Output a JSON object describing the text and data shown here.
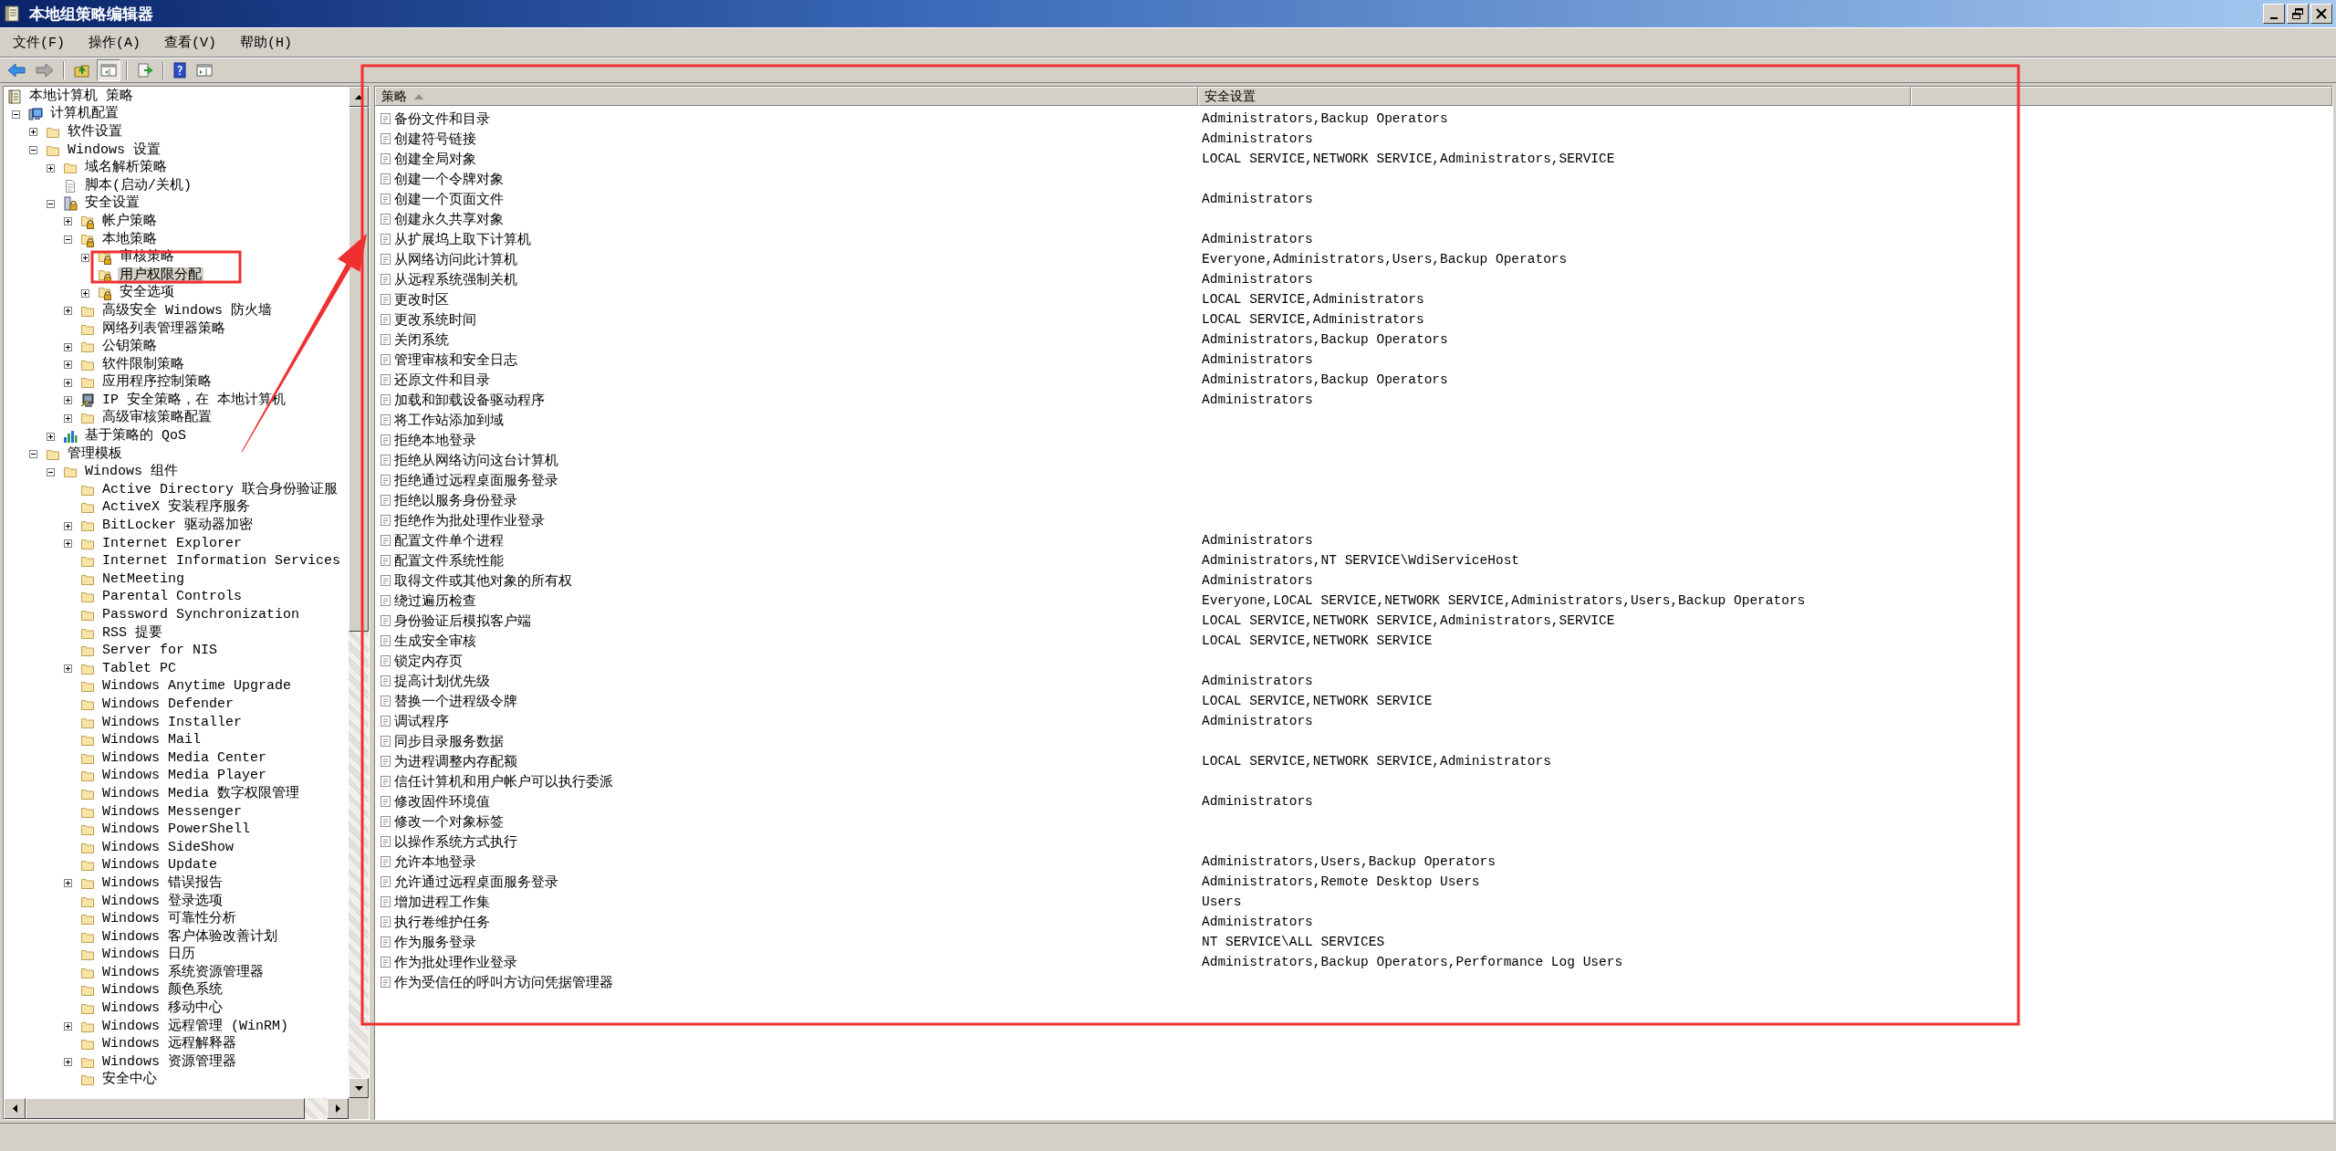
{
  "window": {
    "title": "本地组策略编辑器"
  },
  "menu": [
    "文件(F)",
    "操作(A)",
    "查看(V)",
    "帮助(H)"
  ],
  "tree": [
    {
      "label": "本地计算机 策略",
      "kind": "root",
      "selected": false,
      "children": [
        {
          "label": "计算机配置",
          "kind": "computer",
          "expanded": true,
          "selected": false,
          "children": [
            {
              "label": "软件设置",
              "kind": "folder",
              "expanded": false,
              "selected": false
            },
            {
              "label": "Windows 设置",
              "kind": "folder",
              "expanded": true,
              "selected": false,
              "children": [
                {
                  "label": "域名解析策略",
                  "kind": "folder",
                  "expanded": false,
                  "selected": false
                },
                {
                  "label": "脚本(启动/关机)",
                  "kind": "script",
                  "selected": false
                },
                {
                  "label": "安全设置",
                  "kind": "security",
                  "expanded": true,
                  "selected": false,
                  "children": [
                    {
                      "label": "帐户策略",
                      "kind": "lock-folder",
                      "expanded": false,
                      "selected": false
                    },
                    {
                      "label": "本地策略",
                      "kind": "lock-folder",
                      "expanded": true,
                      "selected": false,
                      "children": [
                        {
                          "label": "审核策略",
                          "kind": "lock-folder",
                          "expanded": false,
                          "selected": false
                        },
                        {
                          "label": "用户权限分配",
                          "kind": "lock-folder",
                          "selected": true
                        },
                        {
                          "label": "安全选项",
                          "kind": "lock-folder",
                          "expanded": false,
                          "selected": false
                        }
                      ]
                    },
                    {
                      "label": "高级安全 Windows 防火墙",
                      "kind": "folder",
                      "expanded": false,
                      "selected": false
                    },
                    {
                      "label": "网络列表管理器策略",
                      "kind": "folder",
                      "selected": false
                    },
                    {
                      "label": "公钥策略",
                      "kind": "folder",
                      "expanded": false,
                      "selected": false
                    },
                    {
                      "label": "软件限制策略",
                      "kind": "folder",
                      "expanded": false,
                      "selected": false
                    },
                    {
                      "label": "应用程序控制策略",
                      "kind": "folder",
                      "expanded": false,
                      "selected": false
                    },
                    {
                      "label": "IP 安全策略，在 本地计算机",
                      "kind": "ip",
                      "expanded": false,
                      "selected": false
                    },
                    {
                      "label": "高级审核策略配置",
                      "kind": "folder",
                      "expanded": false,
                      "selected": false
                    }
                  ]
                },
                {
                  "label": "基于策略的 QoS",
                  "kind": "chart",
                  "expanded": false,
                  "selected": false
                }
              ]
            },
            {
              "label": "管理模板",
              "kind": "folder",
              "expanded": true,
              "selected": false,
              "children": [
                {
                  "label": "Windows 组件",
                  "kind": "folder",
                  "expanded": true,
                  "selected": false,
                  "children": [
                    {
                      "label": "Active Directory 联合身份验证服",
                      "kind": "folder",
                      "selected": false
                    },
                    {
                      "label": "ActiveX 安装程序服务",
                      "kind": "folder",
                      "selected": false
                    },
                    {
                      "label": "BitLocker 驱动器加密",
                      "kind": "folder",
                      "expanded": false,
                      "selected": false
                    },
                    {
                      "label": "Internet Explorer",
                      "kind": "folder",
                      "expanded": false,
                      "selected": false
                    },
                    {
                      "label": "Internet Information Services",
                      "kind": "folder",
                      "selected": false
                    },
                    {
                      "label": "NetMeeting",
                      "kind": "folder",
                      "selected": false
                    },
                    {
                      "label": "Parental Controls",
                      "kind": "folder",
                      "selected": false
                    },
                    {
                      "label": "Password Synchronization",
                      "kind": "folder",
                      "selected": false
                    },
                    {
                      "label": "RSS 提要",
                      "kind": "folder",
                      "selected": false
                    },
                    {
                      "label": "Server for NIS",
                      "kind": "folder",
                      "selected": false
                    },
                    {
                      "label": "Tablet PC",
                      "kind": "folder",
                      "expanded": false,
                      "selected": false
                    },
                    {
                      "label": "Windows Anytime Upgrade",
                      "kind": "folder",
                      "selected": false
                    },
                    {
                      "label": "Windows Defender",
                      "kind": "folder",
                      "selected": false
                    },
                    {
                      "label": "Windows Installer",
                      "kind": "folder",
                      "selected": false
                    },
                    {
                      "label": "Windows Mail",
                      "kind": "folder",
                      "selected": false
                    },
                    {
                      "label": "Windows Media Center",
                      "kind": "folder",
                      "selected": false
                    },
                    {
                      "label": "Windows Media Player",
                      "kind": "folder",
                      "selected": false
                    },
                    {
                      "label": "Windows Media 数字权限管理",
                      "kind": "folder",
                      "selected": false
                    },
                    {
                      "label": "Windows Messenger",
                      "kind": "folder",
                      "selected": false
                    },
                    {
                      "label": "Windows PowerShell",
                      "kind": "folder",
                      "selected": false
                    },
                    {
                      "label": "Windows SideShow",
                      "kind": "folder",
                      "selected": false
                    },
                    {
                      "label": "Windows Update",
                      "kind": "folder",
                      "selected": false
                    },
                    {
                      "label": "Windows 错误报告",
                      "kind": "folder",
                      "expanded": false,
                      "selected": false
                    },
                    {
                      "label": "Windows 登录选项",
                      "kind": "folder",
                      "selected": false
                    },
                    {
                      "label": "Windows 可靠性分析",
                      "kind": "folder",
                      "selected": false
                    },
                    {
                      "label": "Windows 客户体验改善计划",
                      "kind": "folder",
                      "selected": false
                    },
                    {
                      "label": "Windows 日历",
                      "kind": "folder",
                      "selected": false
                    },
                    {
                      "label": "Windows 系统资源管理器",
                      "kind": "folder",
                      "selected": false
                    },
                    {
                      "label": "Windows 颜色系统",
                      "kind": "folder",
                      "selected": false
                    },
                    {
                      "label": "Windows 移动中心",
                      "kind": "folder",
                      "selected": false
                    },
                    {
                      "label": "Windows 远程管理 (WinRM)",
                      "kind": "folder",
                      "expanded": false,
                      "selected": false
                    },
                    {
                      "label": "Windows 远程解释器",
                      "kind": "folder",
                      "selected": false
                    },
                    {
                      "label": "Windows 资源管理器",
                      "kind": "folder",
                      "expanded": false,
                      "selected": false
                    },
                    {
                      "label": "安全中心",
                      "kind": "folder",
                      "selected": false
                    }
                  ]
                }
              ]
            }
          ]
        }
      ]
    }
  ],
  "table": {
    "columns": [
      "策略",
      "安全设置"
    ],
    "rows": [
      {
        "policy": "备份文件和目录",
        "setting": "Administrators,Backup Operators"
      },
      {
        "policy": "创建符号链接",
        "setting": "Administrators"
      },
      {
        "policy": "创建全局对象",
        "setting": "LOCAL SERVICE,NETWORK SERVICE,Administrators,SERVICE"
      },
      {
        "policy": "创建一个令牌对象"
      },
      {
        "policy": "创建一个页面文件",
        "setting": "Administrators"
      },
      {
        "policy": "创建永久共享对象"
      },
      {
        "policy": "从扩展坞上取下计算机",
        "setting": "Administrators"
      },
      {
        "policy": "从网络访问此计算机",
        "setting": "Everyone,Administrators,Users,Backup Operators"
      },
      {
        "policy": "从远程系统强制关机",
        "setting": "Administrators"
      },
      {
        "policy": "更改时区",
        "setting": "LOCAL SERVICE,Administrators"
      },
      {
        "policy": "更改系统时间",
        "setting": "LOCAL SERVICE,Administrators"
      },
      {
        "policy": "关闭系统",
        "setting": "Administrators,Backup Operators"
      },
      {
        "policy": "管理审核和安全日志",
        "setting": "Administrators"
      },
      {
        "policy": "还原文件和目录",
        "setting": "Administrators,Backup Operators"
      },
      {
        "policy": "加载和卸载设备驱动程序",
        "setting": "Administrators"
      },
      {
        "policy": "将工作站添加到域"
      },
      {
        "policy": "拒绝本地登录"
      },
      {
        "policy": "拒绝从网络访问这台计算机"
      },
      {
        "policy": "拒绝通过远程桌面服务登录"
      },
      {
        "policy": "拒绝以服务身份登录"
      },
      {
        "policy": "拒绝作为批处理作业登录"
      },
      {
        "policy": "配置文件单个进程",
        "setting": "Administrators"
      },
      {
        "policy": "配置文件系统性能",
        "setting": "Administrators,NT SERVICE\\WdiServiceHost"
      },
      {
        "policy": "取得文件或其他对象的所有权",
        "setting": "Administrators"
      },
      {
        "policy": "绕过遍历检查",
        "setting": "Everyone,LOCAL SERVICE,NETWORK SERVICE,Administrators,Users,Backup Operators"
      },
      {
        "policy": "身份验证后模拟客户端",
        "setting": "LOCAL SERVICE,NETWORK SERVICE,Administrators,SERVICE"
      },
      {
        "policy": "生成安全审核",
        "setting": "LOCAL SERVICE,NETWORK SERVICE"
      },
      {
        "policy": "锁定内存页"
      },
      {
        "policy": "提高计划优先级",
        "setting": "Administrators"
      },
      {
        "policy": "替换一个进程级令牌",
        "setting": "LOCAL SERVICE,NETWORK SERVICE"
      },
      {
        "policy": "调试程序",
        "setting": "Administrators"
      },
      {
        "policy": "同步目录服务数据"
      },
      {
        "policy": "为进程调整内存配额",
        "setting": "LOCAL SERVICE,NETWORK SERVICE,Administrators"
      },
      {
        "policy": "信任计算机和用户帐户可以执行委派"
      },
      {
        "policy": "修改固件环境值",
        "setting": "Administrators"
      },
      {
        "policy": "修改一个对象标签"
      },
      {
        "policy": "以操作系统方式执行"
      },
      {
        "policy": "允许本地登录",
        "setting": "Administrators,Users,Backup Operators"
      },
      {
        "policy": "允许通过远程桌面服务登录",
        "setting": "Administrators,Remote Desktop Users"
      },
      {
        "policy": "增加进程工作集",
        "setting": "Users"
      },
      {
        "policy": "执行卷维护任务",
        "setting": "Administrators"
      },
      {
        "policy": "作为服务登录",
        "setting": "NT SERVICE\\ALL SERVICES"
      },
      {
        "policy": "作为批处理作业登录",
        "setting": "Administrators,Backup Operators,Performance Log Users"
      },
      {
        "policy": "作为受信任的呼叫方访问凭据管理器"
      }
    ]
  },
  "annotations": [
    {
      "kind": "box"
    },
    {
      "kind": "box"
    },
    {
      "kind": "arrow"
    }
  ]
}
